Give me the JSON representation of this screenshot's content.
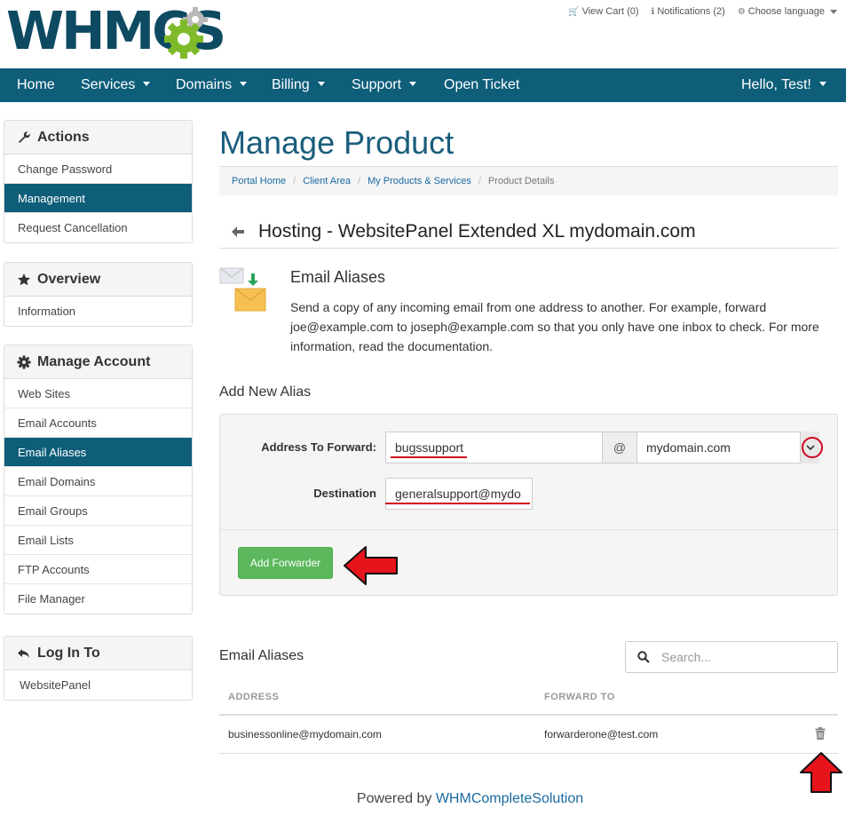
{
  "header": {
    "logo_text": "WHMCS",
    "top_links": [
      {
        "icon": "cart-icon",
        "label": "View Cart (0)"
      },
      {
        "icon": "info-icon",
        "label": "Notifications (2)"
      },
      {
        "icon": "language-icon",
        "label": "Choose language"
      }
    ]
  },
  "nav": {
    "items": [
      {
        "label": "Home",
        "has_caret": false
      },
      {
        "label": "Services",
        "has_caret": true
      },
      {
        "label": "Domains",
        "has_caret": true
      },
      {
        "label": "Billing",
        "has_caret": true
      },
      {
        "label": "Support",
        "has_caret": true
      },
      {
        "label": "Open Ticket",
        "has_caret": false
      }
    ],
    "user_label": "Hello, Test!"
  },
  "sidebar": {
    "actions": {
      "title": "Actions",
      "items": [
        "Change Password",
        "Management",
        "Request Cancellation"
      ],
      "active_index": 1
    },
    "overview": {
      "title": "Overview",
      "items": [
        "Information"
      ]
    },
    "manage_account": {
      "title": "Manage Account",
      "items": [
        "Web Sites",
        "Email Accounts",
        "Email Aliases",
        "Email Domains",
        "Email Groups",
        "Email Lists",
        "FTP Accounts",
        "File Manager"
      ],
      "active_index": 2
    },
    "log_in_to": {
      "title": "Log In To",
      "items": [
        "WebsitePanel"
      ]
    }
  },
  "main": {
    "page_title": "Manage Product",
    "breadcrumb": [
      "Portal Home",
      "Client Area",
      "My Products & Services",
      "Product Details"
    ],
    "product_name": "Hosting - WebsitePanel Extended XL mydomain.com",
    "section_title": "Email Aliases",
    "section_desc": "Send a copy of any incoming email from one address to another. For example, forward joe@example.com to joseph@example.com so that you only have one inbox to check. For more information, read the documentation.",
    "add_title": "Add New Alias",
    "form": {
      "address_label": "Address To Forward:",
      "address_value": "bugssupport",
      "at_symbol": "@",
      "domain_value": "mydomain.com",
      "destination_label": "Destination",
      "destination_value": "generalsupport@mydo",
      "submit_label": "Add Forwarder"
    },
    "list_title": "Email Aliases",
    "search_placeholder": "Search...",
    "table": {
      "columns": [
        "ADDRESS",
        "FORWARD TO"
      ],
      "rows": [
        {
          "address": "businessonline@mydomain.com",
          "forward_to": "forwarderone@test.com"
        }
      ]
    }
  },
  "footer": {
    "prefix": "Powered by ",
    "link": "WHMCompleteSolution"
  },
  "colors": {
    "nav_bg": "#0e5e7a",
    "brand": "#0e4a62",
    "logo_gear": "#7fba2a",
    "accent_green": "#5cb85c",
    "annotation_red": "#d0021b",
    "link_blue": "#1a6aa0"
  }
}
